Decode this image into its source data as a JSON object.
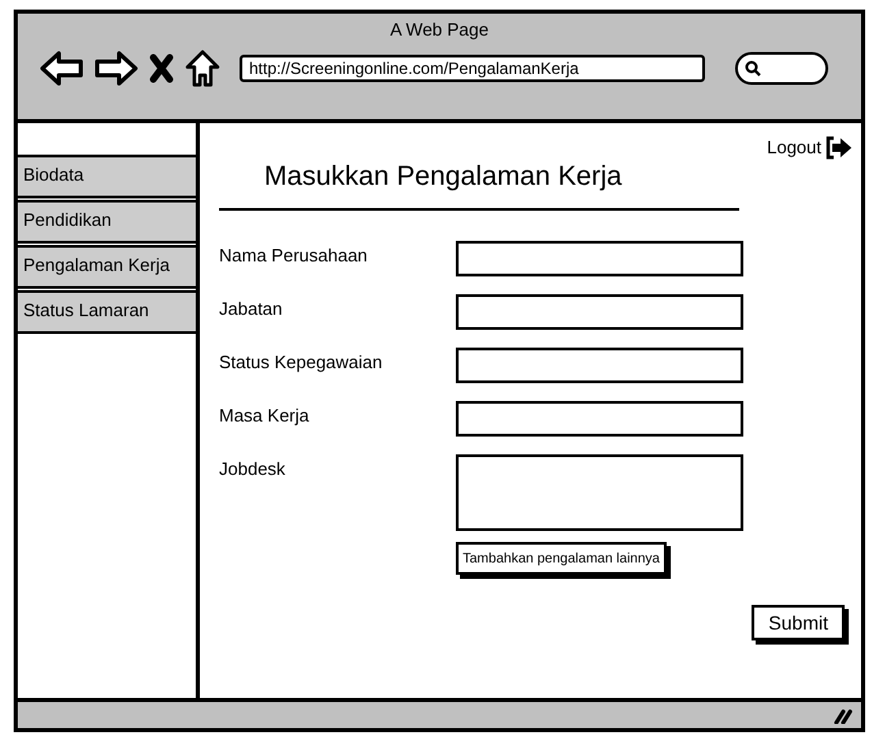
{
  "window": {
    "title": "A Web Page",
    "url": "http://Screeningonline.com/PengalamanKerja"
  },
  "sidebar": {
    "items": [
      {
        "label": "Biodata"
      },
      {
        "label": "Pendidikan"
      },
      {
        "label": "Pengalaman Kerja"
      },
      {
        "label": "Status Lamaran"
      }
    ]
  },
  "logout": "Logout",
  "form": {
    "title": "Masukkan Pengalaman Kerja",
    "fields": [
      {
        "label": "Nama Perusahaan",
        "kind": "input"
      },
      {
        "label": "Jabatan",
        "kind": "input"
      },
      {
        "label": "Status Kepegawaian",
        "kind": "input"
      },
      {
        "label": "Masa Kerja",
        "kind": "input"
      },
      {
        "label": "Jobdesk",
        "kind": "textarea"
      }
    ],
    "add_button": "Tambahkan pengalaman lainnya",
    "submit": "Submit"
  }
}
